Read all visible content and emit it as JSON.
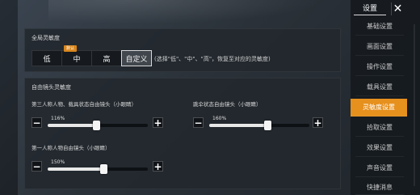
{
  "sidebar": {
    "title": "设置",
    "items": [
      {
        "label": "基础设置",
        "active": false
      },
      {
        "label": "画面设置",
        "active": false
      },
      {
        "label": "操作设置",
        "active": false
      },
      {
        "label": "载具设置",
        "active": false
      },
      {
        "label": "灵敏度设置",
        "active": true
      },
      {
        "label": "拾取设置",
        "active": false
      },
      {
        "label": "效果设置",
        "active": false
      },
      {
        "label": "声音设置",
        "active": false
      },
      {
        "label": "快捷消息",
        "active": false
      }
    ]
  },
  "global_sensitivity": {
    "title": "全局灵敏度",
    "badge": "默认",
    "options": [
      "低",
      "中",
      "高",
      "自定义"
    ],
    "selected": "自定义",
    "hint": "(选择\"低\"、\"中\"、\"高\"，恢复至对应的灵敏度)"
  },
  "free_camera": {
    "title": "自由镜头灵敏度",
    "sliders": [
      {
        "label": "第三人称人物、载具状态自由镜头（小眼睛）",
        "value": "116%",
        "fraction": 0.48
      },
      {
        "label": "跳伞状态自由镜头（小眼睛）",
        "value": "160%",
        "fraction": 0.58
      },
      {
        "label": "第一人称人物自由镜头（小眼睛）",
        "value": "150%",
        "fraction": 0.56
      }
    ]
  },
  "icons": {
    "close": "close-icon",
    "minus": "minus-icon",
    "plus": "plus-icon"
  }
}
